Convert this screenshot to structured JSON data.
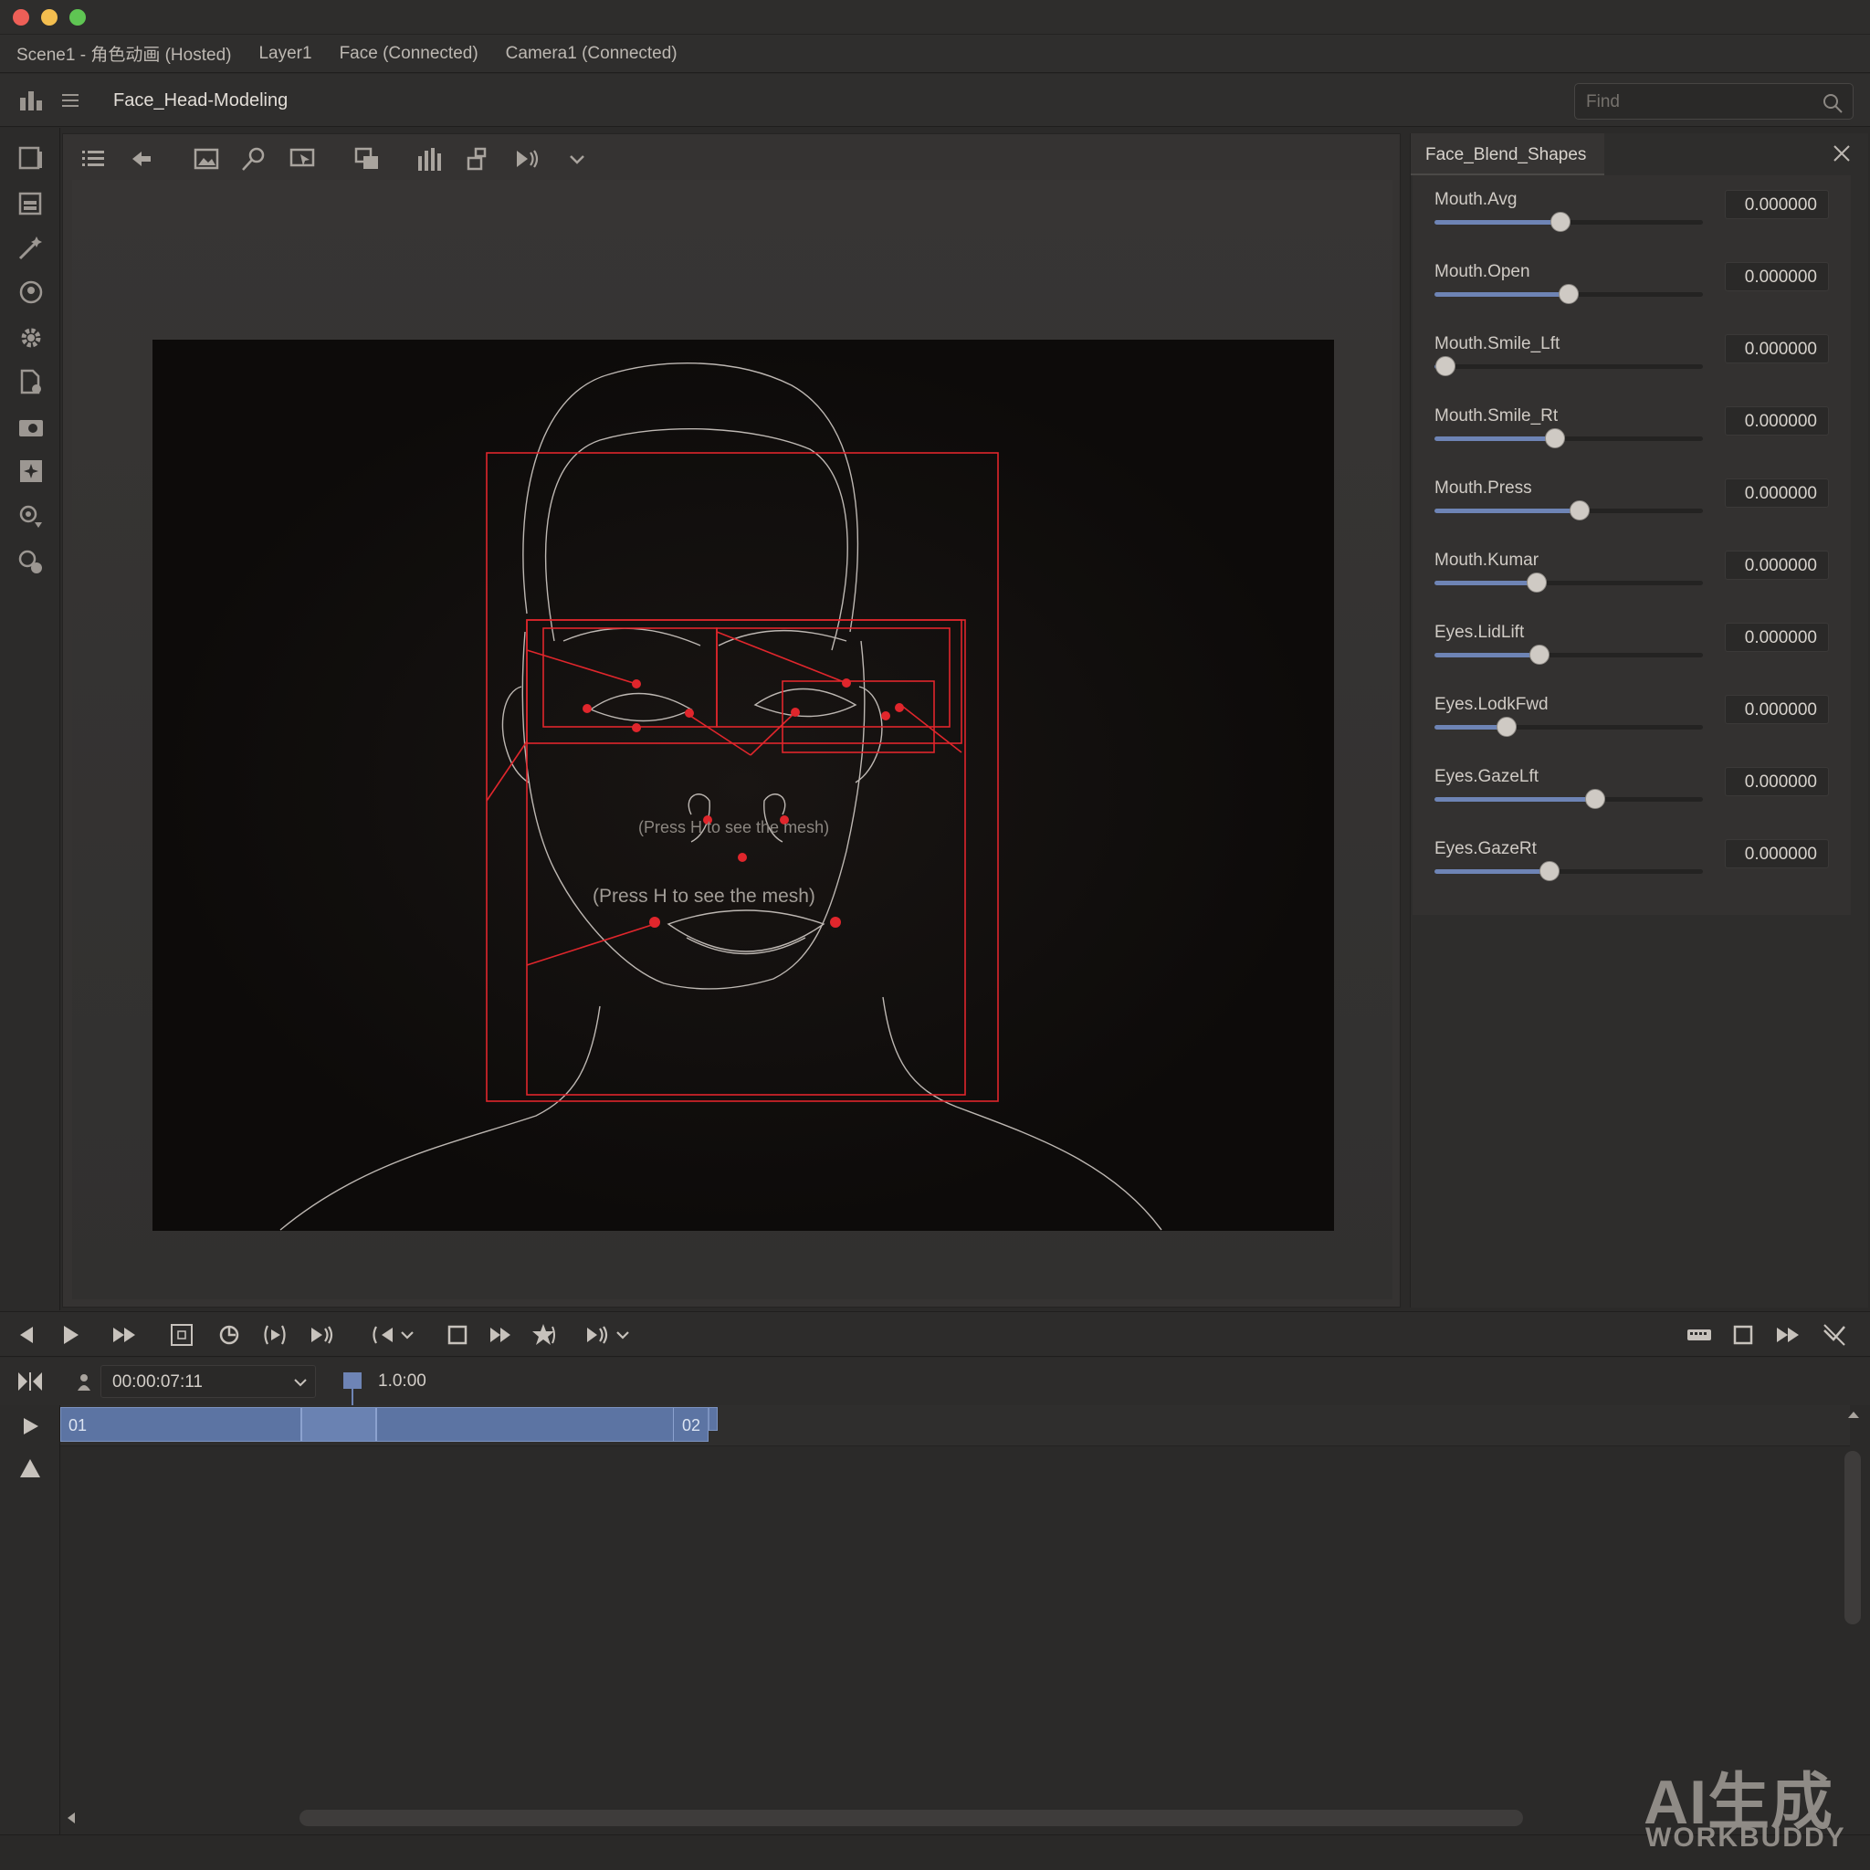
{
  "window": {
    "traffic_colors": [
      "#ee5f57",
      "#f3be4f",
      "#5fc553"
    ]
  },
  "tabs": [
    {
      "label": "Scene1 - 角色动画 (Hosted)"
    },
    {
      "label": "Layer1"
    },
    {
      "label": "Face (Connected)"
    },
    {
      "label": "Camera1 (Connected)"
    }
  ],
  "doc": {
    "title": "Face_Head-Modeling",
    "find_placeholder": "Find"
  },
  "left_tools": [
    "panel-icon",
    "layers-icon",
    "magic-wand-icon",
    "orbit-icon",
    "gear-icon",
    "page-add-icon",
    "camera-icon",
    "add-frame-icon",
    "search-down-icon",
    "shapes-icon"
  ],
  "viewport_toolbar": [
    "list-icon",
    "back-arrow-icon",
    "image-icon",
    "pin-tool-icon",
    "screen-cursor-icon",
    "duplicate-icon",
    "bars-icon",
    "transform-icon",
    "play-forward-icon",
    "chevron-down-icon"
  ],
  "viewport": {
    "hint_small": "(Press H to see the mesh)",
    "hint_large": "(Press H to see the mesh)",
    "overlay_color": "#e0262c",
    "mesh_color": "#bdb7b2"
  },
  "panel": {
    "tab_label": "Face_Blend_Shapes",
    "accent": "#6e84b5",
    "sliders": [
      {
        "label": "Mouth.Avg",
        "value": "0.000000",
        "level": 0.47
      },
      {
        "label": "Mouth.Open",
        "value": "0.000000",
        "level": 0.5
      },
      {
        "label": "Mouth.Smile_Lft",
        "value": "0.000000",
        "level": 0.04
      },
      {
        "label": "Mouth.Smile_Rt",
        "value": "0.000000",
        "level": 0.45
      },
      {
        "label": "Mouth.Press",
        "value": "0.000000",
        "level": 0.54
      },
      {
        "label": "Mouth.Kumar",
        "value": "0.000000",
        "level": 0.38
      },
      {
        "label": "Eyes.LidLift",
        "value": "0.000000",
        "level": 0.39
      },
      {
        "label": "Eyes.LodkFwd",
        "value": "0.000000",
        "level": 0.27
      },
      {
        "label": "Eyes.GazeLft",
        "value": "0.000000",
        "level": 0.6
      },
      {
        "label": "Eyes.GazeRt",
        "value": "0.000000",
        "level": 0.43
      }
    ]
  },
  "transport": {
    "left_buttons": [
      "step-back-icon",
      "play-icon",
      "fast-forward-icon",
      "frame-icon",
      "loop-icon",
      "play-circle-icon",
      "play-next-icon",
      "rewind-menu-icon",
      "stop-icon",
      "skip-forward-icon",
      "record-icon",
      "play-menu-icon"
    ],
    "right_buttons": [
      "keyboard-icon",
      "square-icon",
      "fast-forward-right-icon",
      "no-sync-icon"
    ]
  },
  "timeline": {
    "current_time": "00:00:07:11",
    "zoom": "1.0:00",
    "clip_start_label": "01",
    "clip_end_label": "02"
  },
  "watermark": {
    "big": "AI生成",
    "small": "WORKBUDDY"
  }
}
